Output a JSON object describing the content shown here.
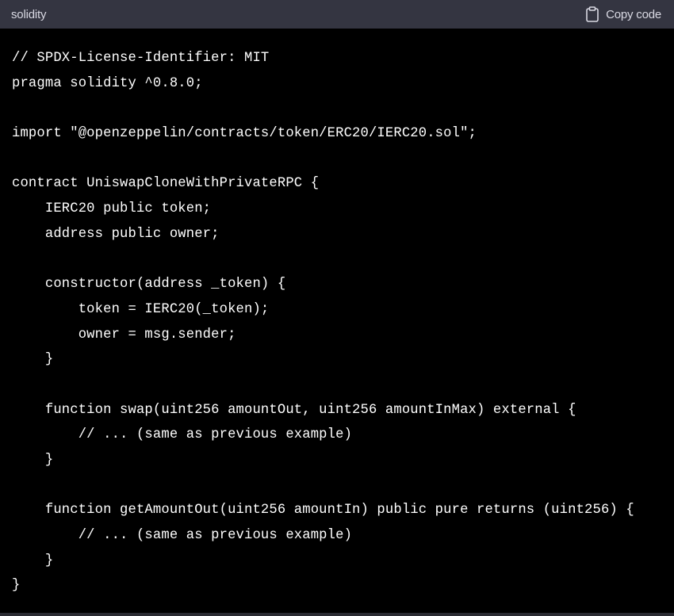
{
  "header": {
    "language": "solidity",
    "copy_label": "Copy code",
    "copy_icon": "clipboard-icon"
  },
  "code": {
    "lines": [
      "// SPDX-License-Identifier: MIT",
      "pragma solidity ^0.8.0;",
      "",
      "import \"@openzeppelin/contracts/token/ERC20/IERC20.sol\";",
      "",
      "contract UniswapCloneWithPrivateRPC {",
      "    IERC20 public token;",
      "    address public owner;",
      "",
      "    constructor(address _token) {",
      "        token = IERC20(_token);",
      "        owner = msg.sender;",
      "    }",
      "",
      "    function swap(uint256 amountOut, uint256 amountInMax) external {",
      "        // ... (same as previous example)",
      "    }",
      "",
      "    function getAmountOut(uint256 amountIn) public pure returns (uint256) {",
      "        // ... (same as previous example)",
      "    }",
      "}"
    ]
  },
  "colors": {
    "background": "#000000",
    "header_background": "#343541",
    "header_text": "#d9d9e3",
    "code_text": "#ffffff"
  }
}
